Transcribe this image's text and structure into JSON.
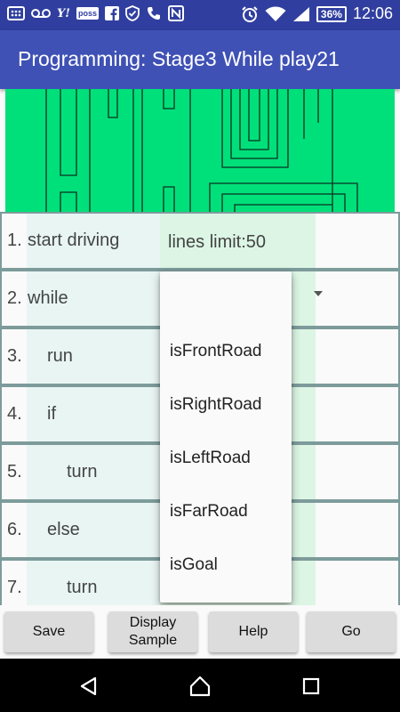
{
  "status_bar": {
    "icons": [
      "notification-grid-icon",
      "voicemail-icon",
      "yahoo-icon",
      "poss-icon",
      "facebook-icon",
      "shield-icon",
      "phone-icon",
      "nfc-icon",
      "alarm-icon",
      "wifi-icon",
      "signal-icon",
      "battery-icon"
    ],
    "yahoo_label": "Y!",
    "poss_label": "poss",
    "battery": "36%",
    "time": "12:06"
  },
  "app_bar": {
    "title": "Programming: Stage3 While play21"
  },
  "maze": {
    "background": "#00E07A",
    "line_color": "#0b3020"
  },
  "program": {
    "lines_limit": "lines limit:50",
    "rows": [
      {
        "number": "1.",
        "command": "start driving"
      },
      {
        "number": "2.",
        "command": "while"
      },
      {
        "number": "3.",
        "command": "run"
      },
      {
        "number": "4.",
        "command": "if"
      },
      {
        "number": "5.",
        "command": "turn"
      },
      {
        "number": "6.",
        "command": "else"
      },
      {
        "number": "7.",
        "command": "turn"
      }
    ]
  },
  "dropdown": {
    "options": [
      "",
      "isFrontRoad",
      "isRightRoad",
      "isLeftRoad",
      "isFarRoad",
      "isGoal"
    ]
  },
  "buttons": {
    "save": "Save",
    "display_sample_1": "Display",
    "display_sample_2": "Sample",
    "help": "Help",
    "go": "Go"
  },
  "nav_bar": {
    "icons": [
      "back-icon",
      "home-icon",
      "recents-icon"
    ]
  },
  "colors": {
    "status_bar": "#303F9F",
    "app_bar": "#3F51B5",
    "row_border": "#7d9b9b",
    "command_column_tint": "#e8f5f3",
    "param_column_tint": "#dcf5e4"
  }
}
